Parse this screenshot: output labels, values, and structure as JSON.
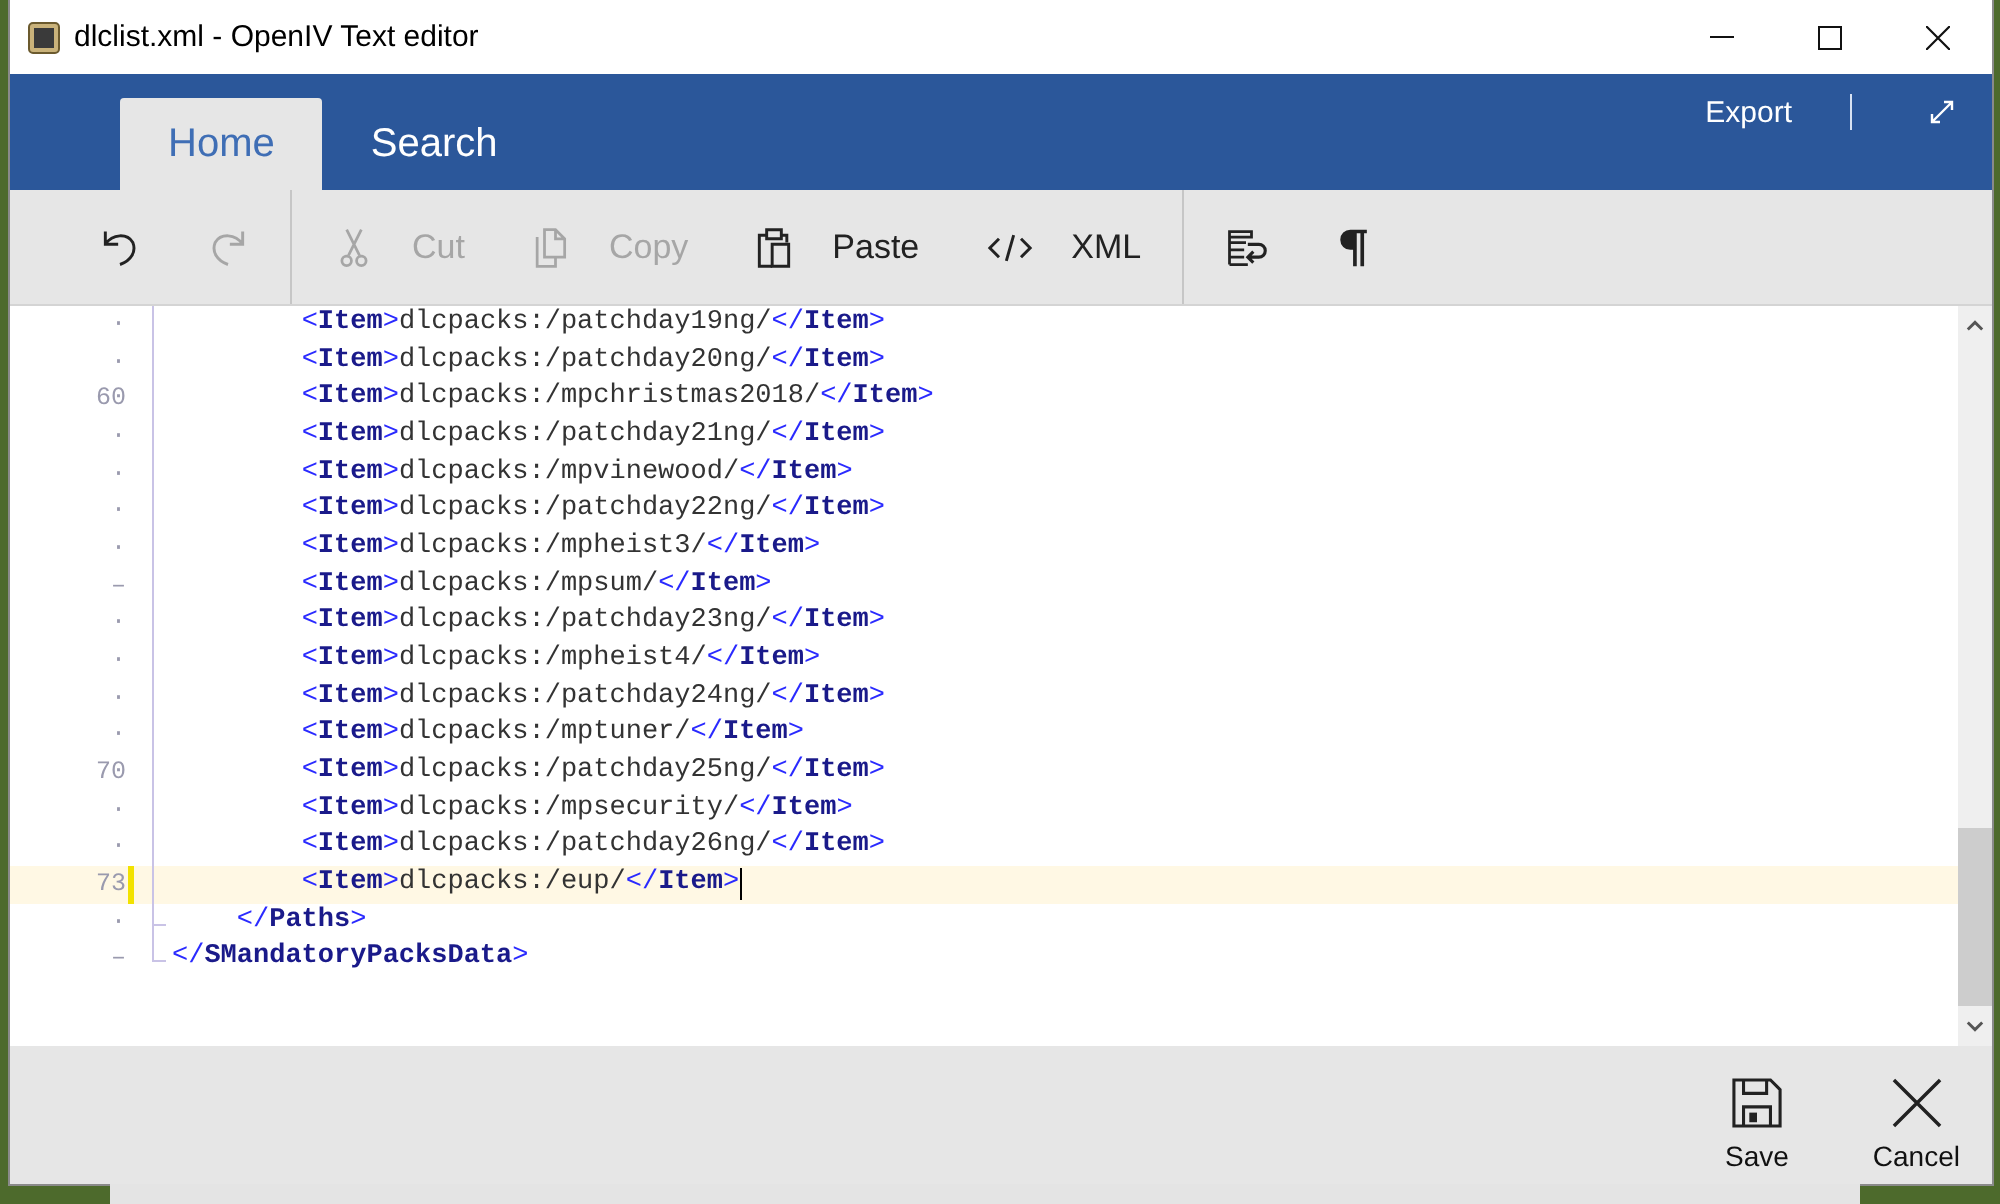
{
  "window": {
    "title": "dlclist.xml - OpenIV Text editor"
  },
  "ribbon": {
    "tabs": [
      {
        "label": "Home",
        "selected": true
      },
      {
        "label": "Search",
        "selected": false
      }
    ],
    "export": "Export"
  },
  "toolbar": {
    "groups": [
      {
        "items": [
          {
            "kind": "undo",
            "disabled": false
          },
          {
            "kind": "redo",
            "disabled": true
          }
        ]
      },
      {
        "items": [
          {
            "kind": "cut",
            "label": "Cut",
            "disabled": true
          },
          {
            "kind": "copy",
            "label": "Copy",
            "disabled": true
          },
          {
            "kind": "paste",
            "label": "Paste",
            "disabled": false
          },
          {
            "kind": "xml",
            "label": "XML",
            "disabled": false
          }
        ]
      },
      {
        "items": [
          {
            "kind": "wrap",
            "disabled": false
          },
          {
            "kind": "pilcrow",
            "disabled": false
          }
        ]
      }
    ]
  },
  "editor": {
    "lines": [
      {
        "gutter": "·",
        "text": "        <Item>dlcpacks:/patchday19ng/</Item>",
        "modified": false,
        "current": false,
        "fold_end": false
      },
      {
        "gutter": "·",
        "text": "        <Item>dlcpacks:/patchday20ng/</Item>",
        "modified": false,
        "current": false,
        "fold_end": false
      },
      {
        "gutter": "60",
        "text": "        <Item>dlcpacks:/mpchristmas2018/</Item>",
        "modified": false,
        "current": false,
        "fold_end": false
      },
      {
        "gutter": "·",
        "text": "        <Item>dlcpacks:/patchday21ng/</Item>",
        "modified": false,
        "current": false,
        "fold_end": false
      },
      {
        "gutter": "·",
        "text": "        <Item>dlcpacks:/mpvinewood/</Item>",
        "modified": false,
        "current": false,
        "fold_end": false
      },
      {
        "gutter": "·",
        "text": "        <Item>dlcpacks:/patchday22ng/</Item>",
        "modified": false,
        "current": false,
        "fold_end": false
      },
      {
        "gutter": "·",
        "text": "        <Item>dlcpacks:/mpheist3/</Item>",
        "modified": false,
        "current": false,
        "fold_end": false
      },
      {
        "gutter": "–",
        "text": "        <Item>dlcpacks:/mpsum/</Item>",
        "modified": false,
        "current": false,
        "fold_end": false
      },
      {
        "gutter": "·",
        "text": "        <Item>dlcpacks:/patchday23ng/</Item>",
        "modified": false,
        "current": false,
        "fold_end": false
      },
      {
        "gutter": "·",
        "text": "        <Item>dlcpacks:/mpheist4/</Item>",
        "modified": false,
        "current": false,
        "fold_end": false
      },
      {
        "gutter": "·",
        "text": "        <Item>dlcpacks:/patchday24ng/</Item>",
        "modified": false,
        "current": false,
        "fold_end": false
      },
      {
        "gutter": "·",
        "text": "        <Item>dlcpacks:/mptuner/</Item>",
        "modified": false,
        "current": false,
        "fold_end": false
      },
      {
        "gutter": "70",
        "text": "        <Item>dlcpacks:/patchday25ng/</Item>",
        "modified": false,
        "current": false,
        "fold_end": false
      },
      {
        "gutter": "·",
        "text": "        <Item>dlcpacks:/mpsecurity/</Item>",
        "modified": false,
        "current": false,
        "fold_end": false
      },
      {
        "gutter": "·",
        "text": "        <Item>dlcpacks:/patchday26ng/</Item>",
        "modified": false,
        "current": false,
        "fold_end": false
      },
      {
        "gutter": "73",
        "text": "        <Item>dlcpacks:/eup/</Item>",
        "modified": true,
        "current": true,
        "fold_end": false
      },
      {
        "gutter": "·",
        "text": "    </Paths>",
        "modified": false,
        "current": false,
        "fold_end": true
      },
      {
        "gutter": "–",
        "text": "</SMandatoryPacksData>",
        "modified": false,
        "current": false,
        "fold_end": true
      }
    ]
  },
  "footer": {
    "buttons": [
      {
        "kind": "save",
        "label": "Save"
      },
      {
        "kind": "cancel",
        "label": "Cancel"
      }
    ]
  }
}
